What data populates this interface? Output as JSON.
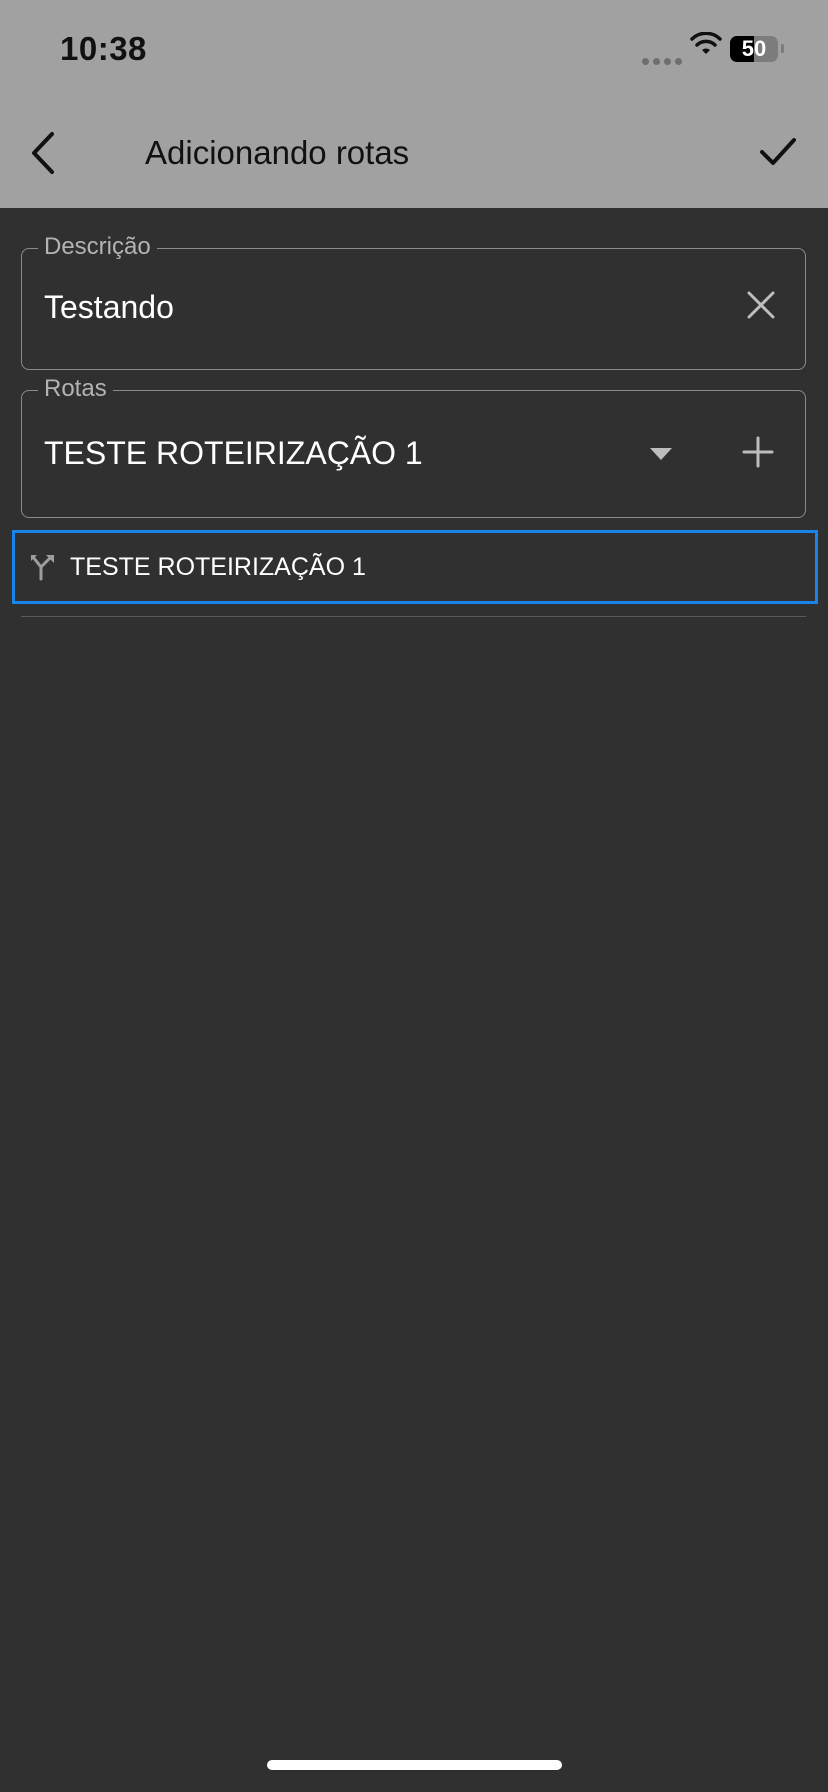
{
  "status_bar": {
    "time": "10:38",
    "battery": "50"
  },
  "header": {
    "title": "Adicionando rotas",
    "back_icon": "chevron-left-icon",
    "confirm_icon": "check-icon"
  },
  "form": {
    "descricao": {
      "label": "Descrição",
      "value": "Testando",
      "clear_icon": "close-icon"
    },
    "rotas": {
      "label": "Rotas",
      "value": "TESTE ROTEIRIZAÇÃO 1",
      "dropdown_icon": "caret-down-icon",
      "add_icon": "plus-icon"
    }
  },
  "routes_list": [
    {
      "label": "TESTE ROTEIRIZAÇÃO 1",
      "icon": "route-fork-icon"
    }
  ],
  "colors": {
    "background": "#303030",
    "header": "#a1a1a1",
    "accent_selection": "#1b84e8"
  }
}
